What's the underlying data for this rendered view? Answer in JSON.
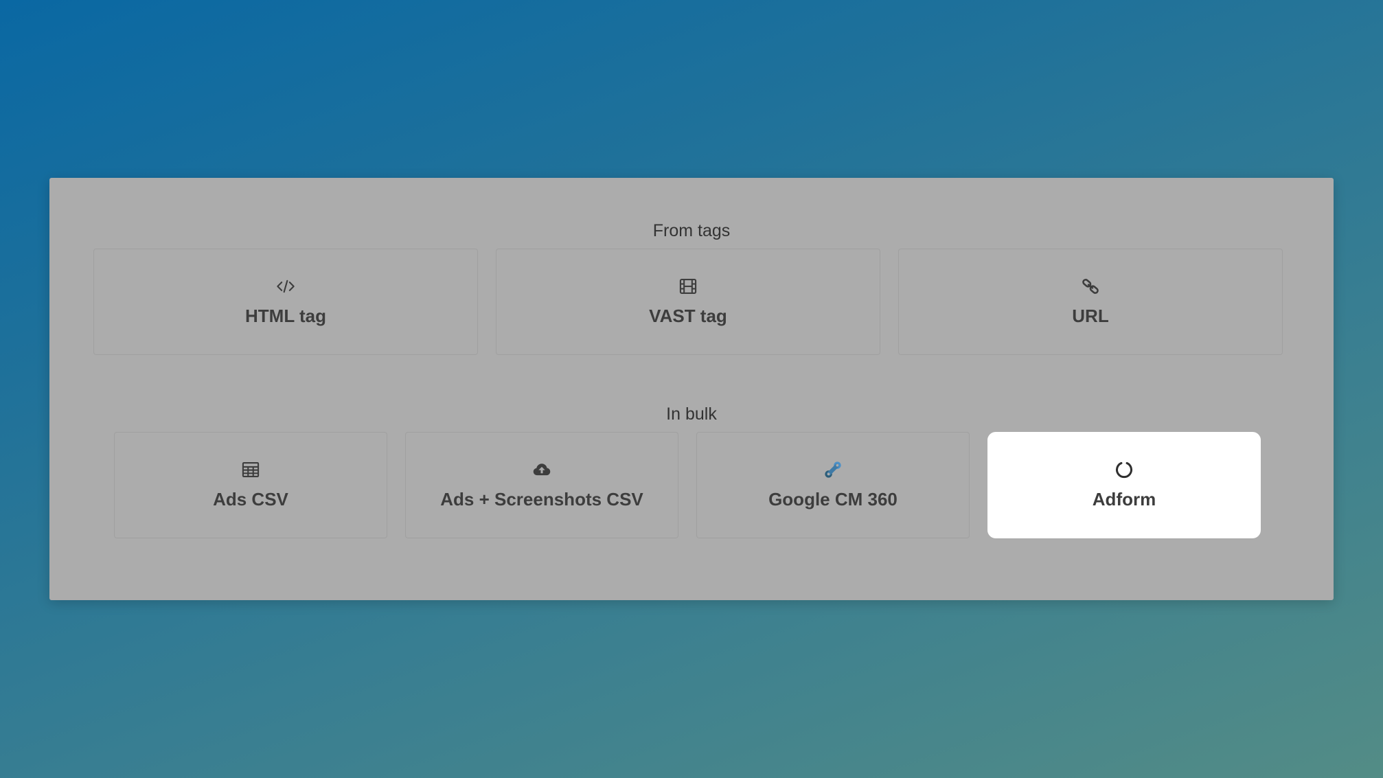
{
  "sections": {
    "from_tags": {
      "title": "From tags",
      "items": [
        {
          "label": "HTML tag",
          "icon": "code-icon"
        },
        {
          "label": "VAST tag",
          "icon": "film-icon"
        },
        {
          "label": "URL",
          "icon": "link-icon"
        }
      ]
    },
    "in_bulk": {
      "title": "In bulk",
      "items": [
        {
          "label": "Ads CSV",
          "icon": "table-icon"
        },
        {
          "label": "Ads + Screenshots CSV",
          "icon": "cloud-upload-icon"
        },
        {
          "label": "Google CM 360",
          "icon": "google-cm360-icon"
        },
        {
          "label": "Adform",
          "icon": "adform-icon",
          "selected": true
        }
      ]
    }
  },
  "colors": {
    "panel": "#acacac",
    "card_text": "#3d3d3d",
    "selected_card": "#ffffff",
    "cm360_blue": "#4a90c8",
    "cm360_dark": "#2c5d78"
  }
}
